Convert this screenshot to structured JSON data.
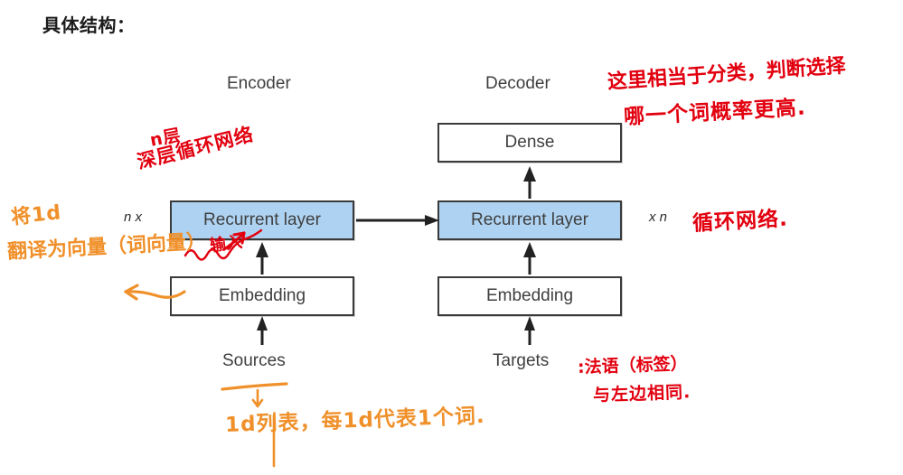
{
  "page": {
    "title": "具体结构："
  },
  "diagram": {
    "encoder_title": "Encoder",
    "decoder_title": "Decoder",
    "encoder": {
      "multiplier": "n x",
      "recurrent_layer": "Recurrent layer",
      "embedding": "Embedding",
      "input_label": "Sources"
    },
    "decoder": {
      "multiplier": "x n",
      "dense": "Dense",
      "recurrent_layer": "Recurrent layer",
      "embedding": "Embedding",
      "input_label": "Targets"
    },
    "colors": {
      "recurrent_fill": "#aed3f2",
      "box_border": "#3a3a3a",
      "box_fill": "#ffffff",
      "text": "#3f3f3f",
      "arrow": "#222222"
    }
  },
  "annotations": {
    "red_color": "#e2000f",
    "orange_color": "#f0902a",
    "items": [
      {
        "id": "deep-rnn-note",
        "color": "red",
        "line1": "n层",
        "line2": "深层循环网络"
      },
      {
        "id": "classification-note",
        "color": "red",
        "line1": "这里相当于分类，判断选择",
        "line2": "哪一个词概率更高."
      },
      {
        "id": "input-note",
        "color": "red",
        "line1": "输入"
      },
      {
        "id": "rnn-note",
        "color": "red",
        "line1": "循环网络."
      },
      {
        "id": "word-vector-note",
        "color": "orange",
        "line1": "将1d",
        "line2": "翻译为向量（词向量）"
      },
      {
        "id": "sources-note",
        "color": "orange",
        "line1": "1d列表，每1d代表1个词."
      },
      {
        "id": "targets-note",
        "color": "red",
        "line1": ":法语（标签）",
        "line2": "与左边相同."
      }
    ]
  }
}
